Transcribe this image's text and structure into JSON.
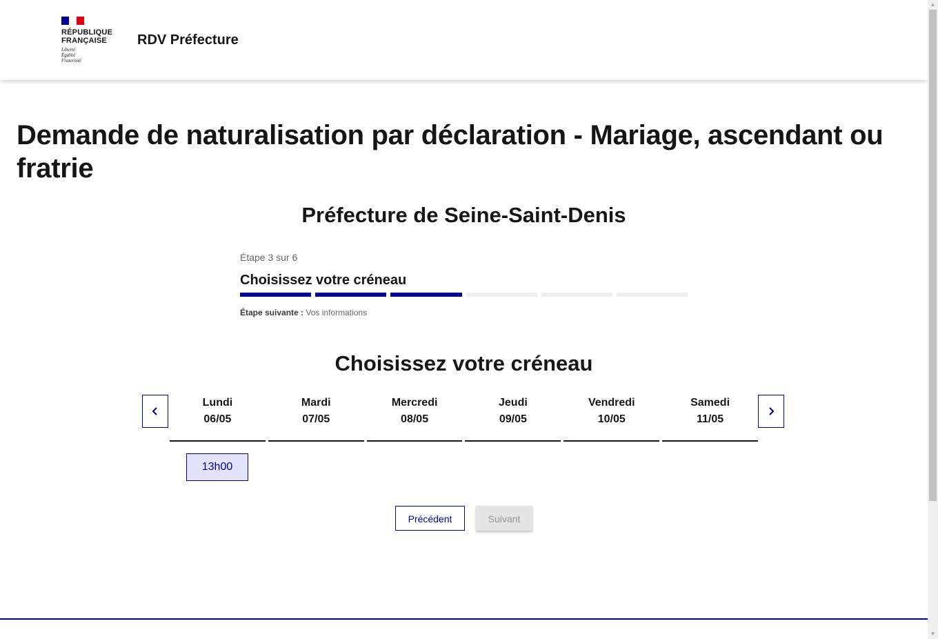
{
  "header": {
    "logo": {
      "flag_colors": [
        "#000091",
        "#ffffff",
        "#e1000f"
      ],
      "line1": "RÉPUBLIQUE",
      "line2": "FRANÇAISE",
      "motto1": "Liberté",
      "motto2": "Égalité",
      "motto3": "Fraternité"
    },
    "service_title": "RDV Préfecture"
  },
  "main": {
    "title": "Demande de naturalisation par déclaration - Mariage, ascendant ou fratrie",
    "prefecture": "Préfecture de Seine-Saint-Denis"
  },
  "stepper": {
    "state": "Étape 3 sur 6",
    "current_title": "Choisissez votre créneau",
    "current_step": 3,
    "total_steps": 6,
    "next_label": "Étape suivante :",
    "next_value": "Vos informations"
  },
  "calendar": {
    "title": "Choisissez votre créneau",
    "prev_icon": "chevron-left-icon",
    "next_icon": "chevron-right-icon",
    "days": [
      {
        "name": "Lundi",
        "date": "06/05"
      },
      {
        "name": "Mardi",
        "date": "07/05"
      },
      {
        "name": "Mercredi",
        "date": "08/05"
      },
      {
        "name": "Jeudi",
        "date": "09/05"
      },
      {
        "name": "Vendredi",
        "date": "10/05"
      },
      {
        "name": "Samedi",
        "date": "11/05"
      }
    ],
    "slots": [
      {
        "day": "Lundi",
        "time": "13h00",
        "selected": true
      }
    ]
  },
  "actions": {
    "previous": "Précédent",
    "next": "Suivant",
    "next_disabled": true
  },
  "colors": {
    "primary": "#000091",
    "slot_background": "#e3e3fd",
    "disabled_background": "#e5e5e5",
    "disabled_text": "#929292"
  }
}
